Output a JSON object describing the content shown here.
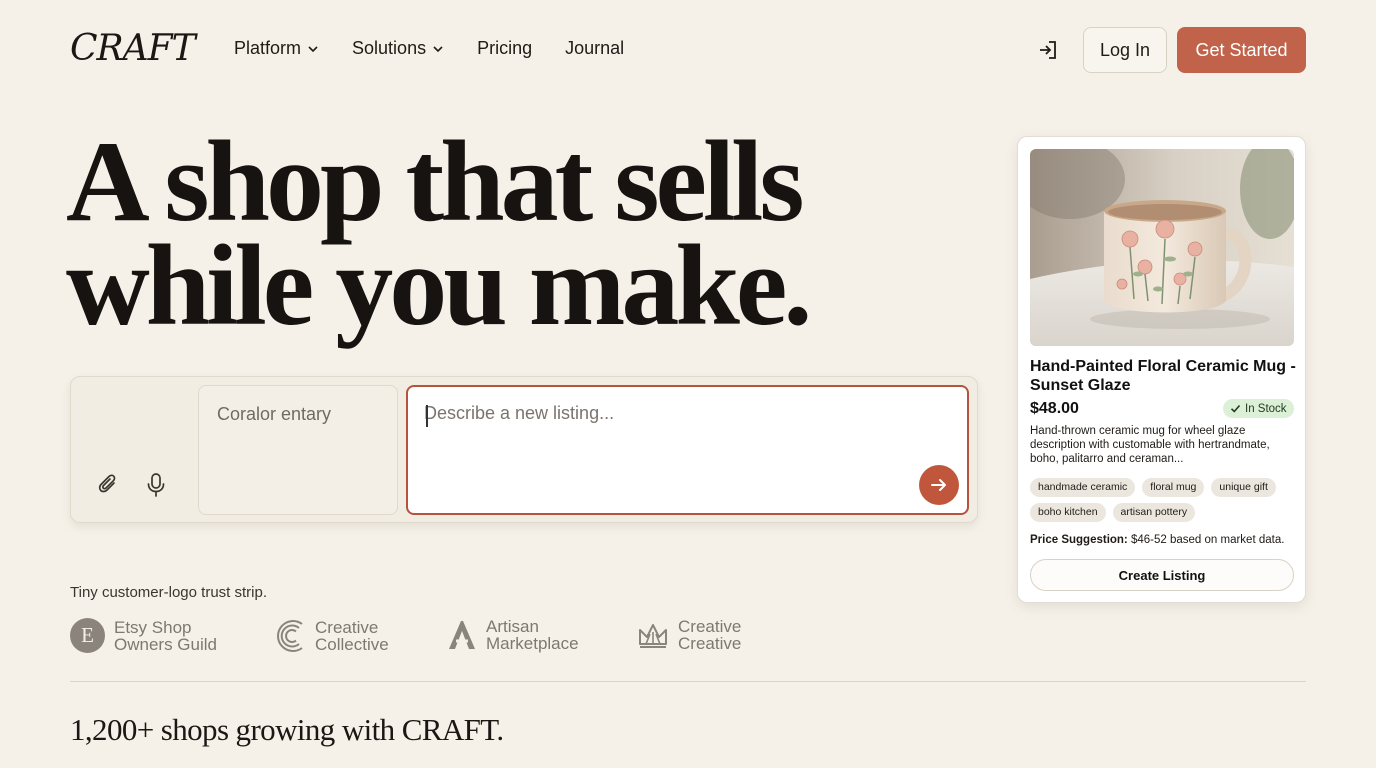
{
  "brand": {
    "logo": "CRAFT"
  },
  "nav": {
    "items": [
      {
        "label": "Platform",
        "has_dropdown": true
      },
      {
        "label": "Solutions",
        "has_dropdown": true
      },
      {
        "label": "Pricing",
        "has_dropdown": false
      },
      {
        "label": "Journal",
        "has_dropdown": false
      }
    ],
    "login_label": "Log In",
    "get_started_label": "Get Started"
  },
  "hero": {
    "title_line1": "A shop that sells",
    "title_line2": "while you make."
  },
  "composer": {
    "side_field_text": "Coralor entary",
    "input_placeholder": "Describe a new listing...",
    "input_value": ""
  },
  "trust": {
    "caption": "Tiny customer-logo trust strip.",
    "logos": [
      {
        "icon": "etsy-e-badge-icon",
        "line1": "Etsy Shop",
        "line2": "Owners Guild"
      },
      {
        "icon": "concentric-c-icon",
        "line1": "Creative",
        "line2": "Collective"
      },
      {
        "icon": "letter-a-icon",
        "line1": "Artisan",
        "line2": "Marketplace"
      },
      {
        "icon": "crown-icon",
        "line1": "Creative",
        "line2": "Creative"
      }
    ],
    "shops_line": "1,200+ shops growing with CRAFT."
  },
  "product_card": {
    "image_icon": "ceramic-mug-photo",
    "title": "Hand-Painted Floral Ceramic Mug - Sunset Glaze",
    "price": "$48.00",
    "stock": "In Stock",
    "description": "Hand-thrown ceramic mug for wheel glaze description with customable with hertrandmate, boho, palitarro and ceraman...",
    "tags": [
      "handmade ceramic",
      "floral mug",
      "unique gift",
      "boho kitchen",
      "artisan pottery"
    ],
    "price_suggestion_label": "Price Suggestion:",
    "price_suggestion_value": " $46-52 based on market data.",
    "create_label": "Create Listing"
  },
  "colors": {
    "background": "#f5f1e8",
    "accent": "#c0634a",
    "stock_green": "#dcefd7"
  }
}
